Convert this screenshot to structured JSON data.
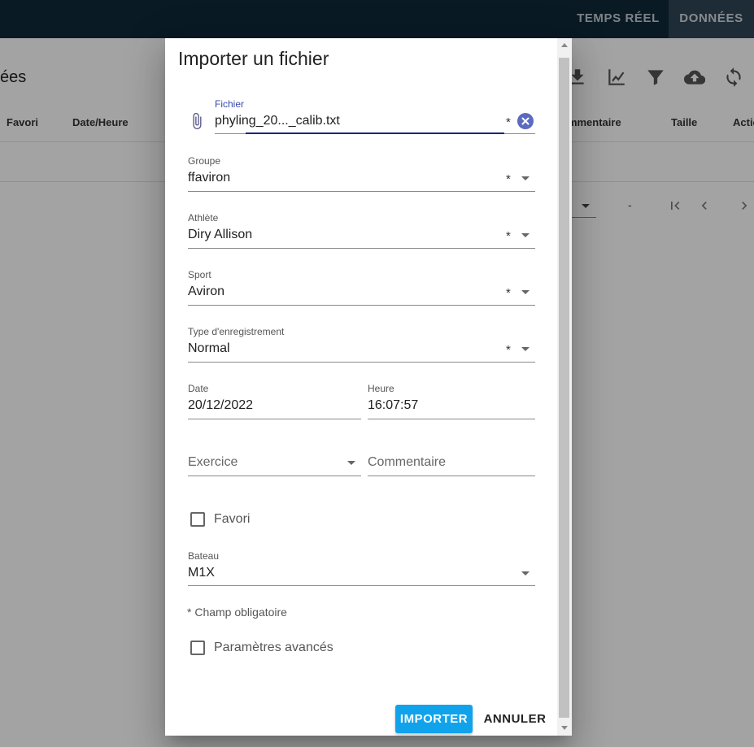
{
  "nav": {
    "realtime": "TEMPS RÉEL",
    "data": "DONNÉES"
  },
  "page": {
    "title": "ées"
  },
  "toolbar": {
    "icons": [
      "download-icon",
      "chart-icon",
      "filter-icon",
      "cloud-upload-icon",
      "refresh-icon"
    ]
  },
  "table": {
    "columns": [
      "Favori",
      "Date/Heure",
      "ommentaire",
      "Taille",
      "Actio"
    ]
  },
  "pager": {
    "dash": "-"
  },
  "dialog": {
    "title": "Importer un fichier",
    "file": {
      "label": "Fichier",
      "value": "phyling_20..._calib.txt",
      "required": "*"
    },
    "group": {
      "label": "Groupe",
      "value": "ffaviron",
      "required": "*"
    },
    "athlete": {
      "label": "Athlète",
      "value": "Diry Allison",
      "required": "*"
    },
    "sport": {
      "label": "Sport",
      "value": "Aviron",
      "required": "*"
    },
    "record_type": {
      "label": "Type d'enregistrement",
      "value": "Normal",
      "required": "*"
    },
    "date": {
      "label": "Date",
      "value": "20/12/2022"
    },
    "time": {
      "label": "Heure",
      "value": "16:07:57"
    },
    "exercise": {
      "placeholder": "Exercice"
    },
    "comment": {
      "placeholder": "Commentaire"
    },
    "favorite": {
      "label": "Favori",
      "checked": false
    },
    "boat": {
      "label": "Bateau",
      "value": "M1X"
    },
    "required_note": "* Champ obligatoire",
    "advanced": {
      "label": "Paramètres avancés",
      "checked": false
    },
    "import_button": "IMPORTER",
    "cancel_button": "ANNULER"
  },
  "colors": {
    "topbar": "#10293a",
    "accent": "#10a3ec",
    "file_underline": "#1a237e",
    "clear_icon": "#3f51b5"
  }
}
